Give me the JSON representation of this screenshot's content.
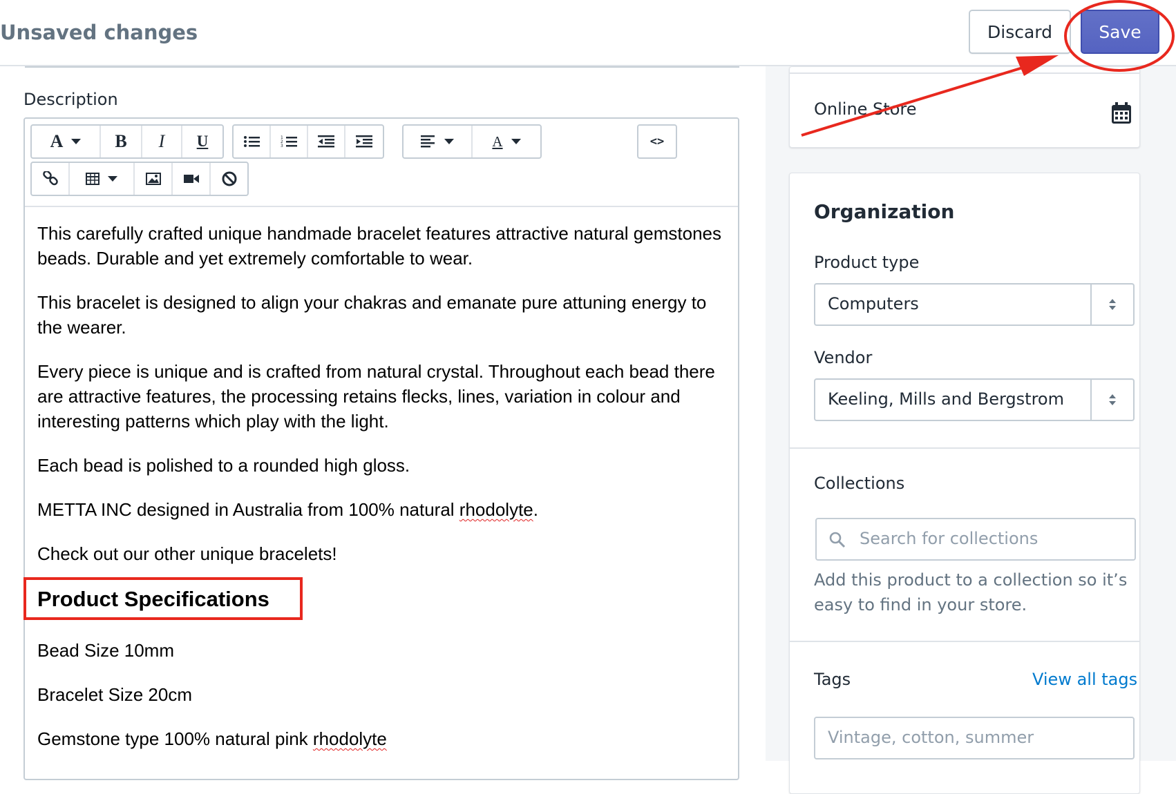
{
  "topbar": {
    "title": "Unsaved changes",
    "discard_label": "Discard",
    "save_label": "Save"
  },
  "description": {
    "label": "Description",
    "toolbar": {
      "row1": [
        "A",
        "B",
        "I",
        "U",
        "bullet-list",
        "numbered-list",
        "outdent",
        "indent",
        "align",
        "A",
        "<>"
      ],
      "row2": [
        "link",
        "table",
        "image",
        "video",
        "clear-format"
      ]
    },
    "paragraphs": [
      "This carefully crafted unique handmade bracelet features attractive natural gemstones beads.  Durable and yet extremely comfortable to wear.",
      "This bracelet is designed to align your chakras and emanate pure attuning energy to the wearer.",
      "Every piece is unique and is crafted from natural crystal.  Throughout each bead there are attractive features, the processing retains flecks, lines, variation in colour and interesting patterns which play with the light.",
      "Each bead is polished to a rounded high gloss."
    ],
    "metta_prefix": "METTA INC designed in Australia from 100% natural ",
    "metta_word": "rhodolyte",
    "metta_suffix": ".",
    "check_out": "Check out our other unique bracelets!",
    "spec_heading": "Product Specifications",
    "bead_size": "Bead Size 10mm",
    "bracelet_size": "Bracelet Size 20cm",
    "gemstone_prefix": "Gemstone type 100% natural pink ",
    "gemstone_word": "rhodolyte"
  },
  "sidebar": {
    "channel_label": "Online Store",
    "organization": {
      "title": "Organization",
      "product_type_label": "Product type",
      "product_type_value": "Computers",
      "vendor_label": "Vendor",
      "vendor_value": "Keeling, Mills and Bergstrom"
    },
    "collections": {
      "title": "Collections",
      "search_placeholder": "Search for collections",
      "help_line1": "Add this product to a collection so it’s",
      "help_line2": "easy to find in your store."
    },
    "tags": {
      "title": "Tags",
      "view_all": "View all tags",
      "placeholder": "Vintage, cotton, summer"
    }
  },
  "colors": {
    "save_button": "#5c6ac4",
    "annotation": "#e8281e",
    "link": "#007ace"
  },
  "icons": {
    "calendar": "calendar-icon",
    "search": "search-icon"
  }
}
